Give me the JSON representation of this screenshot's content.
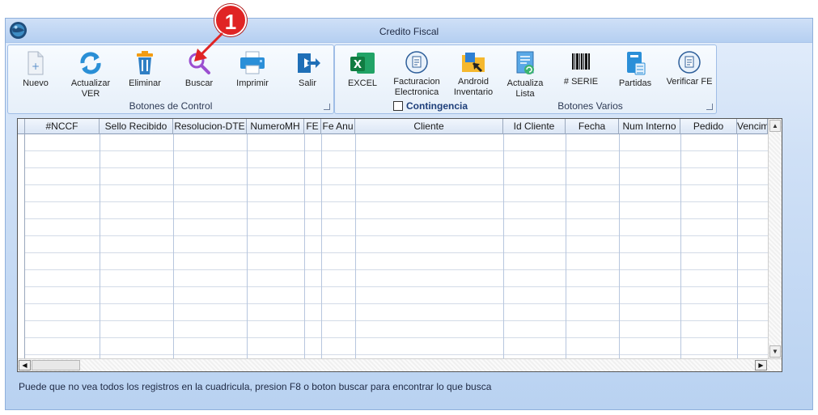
{
  "window": {
    "title": "Credito Fiscal"
  },
  "control_group": {
    "caption": "Botones de Control",
    "buttons": [
      {
        "id": "nuevo",
        "label": "Nuevo",
        "icon": "new-document-icon"
      },
      {
        "id": "actualizar",
        "label": "Actualizar VER",
        "icon": "refresh-icon"
      },
      {
        "id": "eliminar",
        "label": "Eliminar",
        "icon": "trash-icon"
      },
      {
        "id": "buscar",
        "label": "Buscar",
        "icon": "search-icon"
      },
      {
        "id": "imprimir",
        "label": "Imprimir",
        "icon": "printer-icon"
      },
      {
        "id": "salir",
        "label": "Salir",
        "icon": "exit-icon"
      }
    ]
  },
  "varios_group": {
    "caption": "Botones Varios",
    "contingencia_label": "Contingencia",
    "contingencia_checked": false,
    "buttons": [
      {
        "id": "excel",
        "label": "EXCEL",
        "icon": "excel-icon"
      },
      {
        "id": "facturacion",
        "label": "Facturacion Electronica",
        "icon": "facturacion-electronica-icon"
      },
      {
        "id": "android",
        "label": "Android Inventario",
        "icon": "folder-icon"
      },
      {
        "id": "actualiza_lista",
        "label": "Actualiza Lista",
        "icon": "list-refresh-icon"
      },
      {
        "id": "serie",
        "label": "# SERIE",
        "icon": "barcode-icon"
      },
      {
        "id": "partidas",
        "label": "Partidas",
        "icon": "ledger-icon"
      },
      {
        "id": "verificar_fe",
        "label": "Verificar FE",
        "icon": "facturacion-electronica-icon"
      }
    ]
  },
  "grid": {
    "columns": [
      "#NCCF",
      "Sello Recibido",
      "Resolucion-DTE",
      "NumeroMH",
      "FE",
      "Fe Anu",
      "Cliente",
      "Id Cliente",
      "Fecha",
      "Num Interno",
      "Pedido",
      "Vencim"
    ],
    "rows": []
  },
  "status_text": "Puede que no vea todos los registros en la cuadricula, presion F8 o boton buscar para encontrar lo que busca",
  "annotation": {
    "number": "1"
  },
  "colors": {
    "accent": "#e02424",
    "window_bg": "#cfe0f6",
    "group_border": "#9fbde6"
  }
}
